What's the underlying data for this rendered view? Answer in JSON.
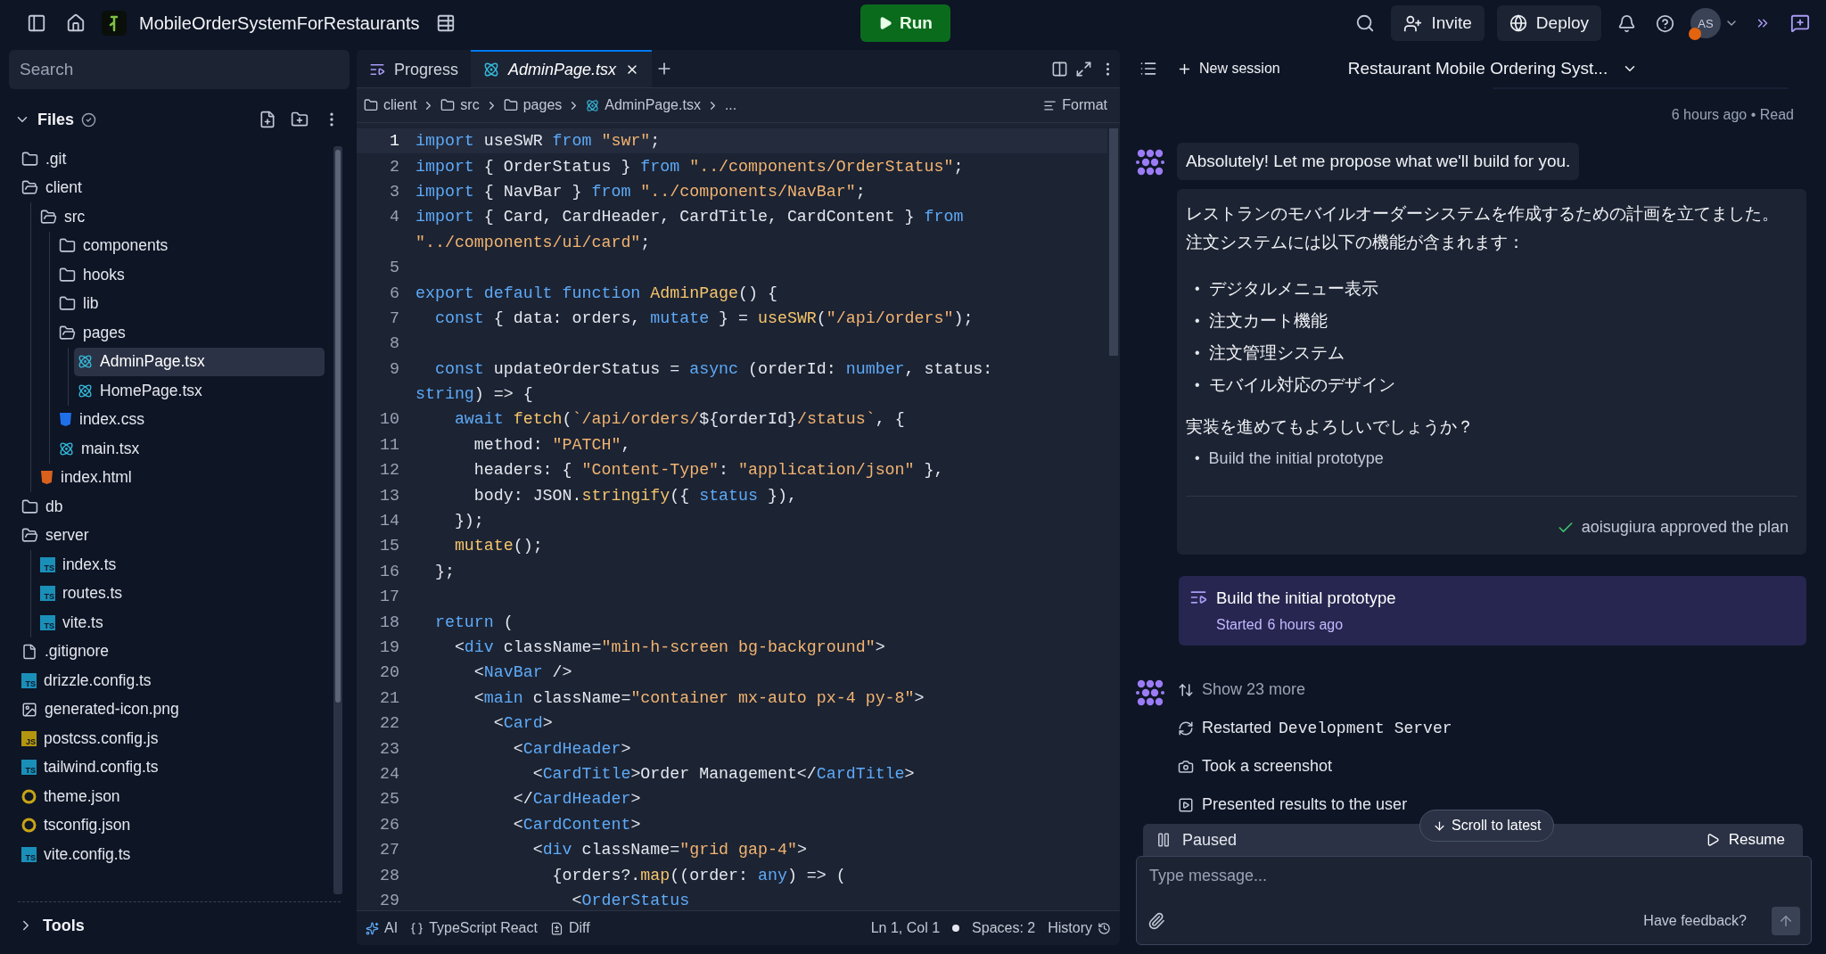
{
  "topbar": {
    "project": "MobileOrderSystemForRestaurants",
    "run": "Run",
    "invite": "Invite",
    "deploy": "Deploy",
    "avatar": "AS"
  },
  "sidebar": {
    "search": {
      "placeholder": "Search"
    },
    "files_label": "Files",
    "tools_label": "Tools",
    "tree": [
      {
        "name": ".git",
        "kind": "folder",
        "expanded": false
      },
      {
        "name": "client",
        "kind": "folder",
        "expanded": true,
        "children": [
          {
            "name": "src",
            "kind": "folder",
            "expanded": true,
            "children": [
              {
                "name": "components",
                "kind": "folder",
                "expanded": false
              },
              {
                "name": "hooks",
                "kind": "folder",
                "expanded": false
              },
              {
                "name": "lib",
                "kind": "folder",
                "expanded": false
              },
              {
                "name": "pages",
                "kind": "folder",
                "expanded": true,
                "children": [
                  {
                    "name": "AdminPage.tsx",
                    "kind": "react",
                    "selected": true
                  },
                  {
                    "name": "HomePage.tsx",
                    "kind": "react",
                    "selected": false
                  }
                ]
              },
              {
                "name": "index.css",
                "kind": "css",
                "selected": false
              },
              {
                "name": "main.tsx",
                "kind": "react",
                "selected": false
              }
            ]
          },
          {
            "name": "index.html",
            "kind": "html",
            "selected": false
          }
        ]
      },
      {
        "name": "db",
        "kind": "folder",
        "expanded": false
      },
      {
        "name": "server",
        "kind": "folder",
        "expanded": true,
        "children": [
          {
            "name": "index.ts",
            "kind": "ts",
            "badge": "TS",
            "selected": false
          },
          {
            "name": "routes.ts",
            "kind": "ts",
            "badge": "TS",
            "selected": false
          },
          {
            "name": "vite.ts",
            "kind": "ts",
            "badge": "TS",
            "selected": false
          }
        ]
      },
      {
        "name": ".gitignore",
        "kind": "file",
        "selected": false
      },
      {
        "name": "drizzle.config.ts",
        "kind": "ts",
        "badge": "TS",
        "selected": false
      },
      {
        "name": "generated-icon.png",
        "kind": "image",
        "selected": false
      },
      {
        "name": "postcss.config.js",
        "kind": "js",
        "badge": "JS",
        "selected": false
      },
      {
        "name": "tailwind.config.ts",
        "kind": "ts",
        "badge": "TS",
        "selected": false
      },
      {
        "name": "theme.json",
        "kind": "json",
        "selected": false
      },
      {
        "name": "tsconfig.json",
        "kind": "json",
        "selected": false
      },
      {
        "name": "vite.config.ts",
        "kind": "ts",
        "badge": "TS",
        "selected": false
      }
    ]
  },
  "editor": {
    "tabs": [
      {
        "label": "Progress",
        "kind": "progress",
        "selected": false
      },
      {
        "label": "AdminPage.tsx",
        "kind": "react",
        "selected": true
      }
    ],
    "breadcrumb": [
      "client",
      "src",
      "pages",
      "AdminPage.tsx",
      "..."
    ],
    "format": "Format",
    "lines": [
      {
        "number": "1",
        "current": true,
        "rows": [
          [
            {
              "text": "import",
              "kind": "keyword"
            },
            {
              "text": " useSWR ",
              "kind": "plain"
            },
            {
              "text": "from",
              "kind": "keyword"
            },
            {
              "text": " ",
              "kind": "plain"
            },
            {
              "text": "\"swr\"",
              "kind": "string"
            },
            {
              "text": ";",
              "kind": "plain"
            }
          ]
        ]
      },
      {
        "number": "2",
        "current": false,
        "rows": [
          [
            {
              "text": "import",
              "kind": "keyword"
            },
            {
              "text": " { OrderStatus } ",
              "kind": "plain"
            },
            {
              "text": "from",
              "kind": "keyword"
            },
            {
              "text": " ",
              "kind": "plain"
            },
            {
              "text": "\"../components/OrderStatus\"",
              "kind": "string"
            },
            {
              "text": ";",
              "kind": "plain"
            }
          ]
        ]
      },
      {
        "number": "3",
        "current": false,
        "rows": [
          [
            {
              "text": "import",
              "kind": "keyword"
            },
            {
              "text": " { NavBar } ",
              "kind": "plain"
            },
            {
              "text": "from",
              "kind": "keyword"
            },
            {
              "text": " ",
              "kind": "plain"
            },
            {
              "text": "\"../components/NavBar\"",
              "kind": "string"
            },
            {
              "text": ";",
              "kind": "plain"
            }
          ]
        ]
      },
      {
        "number": "4",
        "current": false,
        "rows": [
          [
            {
              "text": "import",
              "kind": "keyword"
            },
            {
              "text": " { Card, CardHeader, CardTitle, CardContent } ",
              "kind": "plain"
            },
            {
              "text": "from",
              "kind": "keyword"
            }
          ],
          [
            {
              "text": "\"../components/ui/card\"",
              "kind": "string"
            },
            {
              "text": ";",
              "kind": "plain"
            }
          ]
        ]
      },
      {
        "number": "5",
        "current": false
      },
      {
        "number": "6",
        "current": false,
        "rows": [
          [
            {
              "text": "export default function",
              "kind": "keyword"
            },
            {
              "text": " ",
              "kind": "plain"
            },
            {
              "text": "AdminPage",
              "kind": "function"
            },
            {
              "text": "() {",
              "kind": "plain"
            }
          ]
        ]
      },
      {
        "number": "7",
        "current": false,
        "rows": [
          [
            {
              "text": "  ",
              "kind": "plain"
            },
            {
              "text": "const",
              "kind": "keyword"
            },
            {
              "text": " { data: orders, ",
              "kind": "plain"
            },
            {
              "text": "mutate",
              "kind": "keyword"
            },
            {
              "text": " } = ",
              "kind": "plain"
            },
            {
              "text": "useSWR",
              "kind": "function"
            },
            {
              "text": "(",
              "kind": "plain"
            },
            {
              "text": "\"/api/orders\"",
              "kind": "string"
            },
            {
              "text": ");",
              "kind": "plain"
            }
          ]
        ]
      },
      {
        "number": "8",
        "current": false
      },
      {
        "number": "9",
        "current": false,
        "rows": [
          [
            {
              "text": "  ",
              "kind": "plain"
            },
            {
              "text": "const",
              "kind": "keyword"
            },
            {
              "text": " updateOrderStatus = ",
              "kind": "plain"
            },
            {
              "text": "async",
              "kind": "keyword"
            },
            {
              "text": " (orderId: ",
              "kind": "plain"
            },
            {
              "text": "number",
              "kind": "keyword"
            },
            {
              "text": ", status:",
              "kind": "plain"
            }
          ],
          [
            {
              "text": "string",
              "kind": "keyword"
            },
            {
              "text": ") => {",
              "kind": "plain"
            }
          ]
        ]
      },
      {
        "number": "10",
        "current": false,
        "rows": [
          [
            {
              "text": "    ",
              "kind": "plain"
            },
            {
              "text": "await",
              "kind": "keyword"
            },
            {
              "text": " ",
              "kind": "plain"
            },
            {
              "text": "fetch",
              "kind": "function"
            },
            {
              "text": "(",
              "kind": "plain"
            },
            {
              "text": "`/api/orders/",
              "kind": "string"
            },
            {
              "text": "${orderId}",
              "kind": "plain"
            },
            {
              "text": "/status`",
              "kind": "string"
            },
            {
              "text": ", {",
              "kind": "plain"
            }
          ]
        ]
      },
      {
        "number": "11",
        "current": false,
        "rows": [
          [
            {
              "text": "      method: ",
              "kind": "plain"
            },
            {
              "text": "\"PATCH\"",
              "kind": "string"
            },
            {
              "text": ",",
              "kind": "plain"
            }
          ]
        ]
      },
      {
        "number": "12",
        "current": false,
        "rows": [
          [
            {
              "text": "      headers: { ",
              "kind": "plain"
            },
            {
              "text": "\"Content-Type\"",
              "kind": "string"
            },
            {
              "text": ": ",
              "kind": "plain"
            },
            {
              "text": "\"application/json\"",
              "kind": "string"
            },
            {
              "text": " },",
              "kind": "plain"
            }
          ]
        ]
      },
      {
        "number": "13",
        "current": false,
        "rows": [
          [
            {
              "text": "      body: JSON.",
              "kind": "plain"
            },
            {
              "text": "stringify",
              "kind": "function"
            },
            {
              "text": "({ ",
              "kind": "plain"
            },
            {
              "text": "status",
              "kind": "keyword"
            },
            {
              "text": " }),",
              "kind": "plain"
            }
          ]
        ]
      },
      {
        "number": "14",
        "current": false,
        "rows": [
          [
            {
              "text": "    });",
              "kind": "plain"
            }
          ]
        ]
      },
      {
        "number": "15",
        "current": false,
        "rows": [
          [
            {
              "text": "    ",
              "kind": "plain"
            },
            {
              "text": "mutate",
              "kind": "function"
            },
            {
              "text": "();",
              "kind": "plain"
            }
          ]
        ]
      },
      {
        "number": "16",
        "current": false,
        "rows": [
          [
            {
              "text": "  };",
              "kind": "plain"
            }
          ]
        ]
      },
      {
        "number": "17",
        "current": false
      },
      {
        "number": "18",
        "current": false,
        "rows": [
          [
            {
              "text": "  ",
              "kind": "plain"
            },
            {
              "text": "return",
              "kind": "keyword"
            },
            {
              "text": " (",
              "kind": "plain"
            }
          ]
        ]
      },
      {
        "number": "19",
        "current": false,
        "rows": [
          [
            {
              "text": "    <",
              "kind": "plain"
            },
            {
              "text": "div",
              "kind": "keyword"
            },
            {
              "text": " className=",
              "kind": "plain"
            },
            {
              "text": "\"min-h-screen bg-background\"",
              "kind": "string"
            },
            {
              "text": ">",
              "kind": "plain"
            }
          ]
        ]
      },
      {
        "number": "20",
        "current": false,
        "rows": [
          [
            {
              "text": "      <",
              "kind": "plain"
            },
            {
              "text": "NavBar",
              "kind": "keyword"
            },
            {
              "text": " />",
              "kind": "plain"
            }
          ]
        ]
      },
      {
        "number": "21",
        "current": false,
        "rows": [
          [
            {
              "text": "      <",
              "kind": "plain"
            },
            {
              "text": "main",
              "kind": "keyword"
            },
            {
              "text": " className=",
              "kind": "plain"
            },
            {
              "text": "\"container mx-auto px-4 py-8\"",
              "kind": "string"
            },
            {
              "text": ">",
              "kind": "plain"
            }
          ]
        ]
      },
      {
        "number": "22",
        "current": false,
        "rows": [
          [
            {
              "text": "        <",
              "kind": "plain"
            },
            {
              "text": "Card",
              "kind": "keyword"
            },
            {
              "text": ">",
              "kind": "plain"
            }
          ]
        ]
      },
      {
        "number": "23",
        "current": false,
        "rows": [
          [
            {
              "text": "          <",
              "kind": "plain"
            },
            {
              "text": "CardHeader",
              "kind": "keyword"
            },
            {
              "text": ">",
              "kind": "plain"
            }
          ]
        ]
      },
      {
        "number": "24",
        "current": false,
        "rows": [
          [
            {
              "text": "            <",
              "kind": "plain"
            },
            {
              "text": "CardTitle",
              "kind": "keyword"
            },
            {
              "text": ">Order Management</",
              "kind": "plain"
            },
            {
              "text": "CardTitle",
              "kind": "keyword"
            },
            {
              "text": ">",
              "kind": "plain"
            }
          ]
        ]
      },
      {
        "number": "25",
        "current": false,
        "rows": [
          [
            {
              "text": "          </",
              "kind": "plain"
            },
            {
              "text": "CardHeader",
              "kind": "keyword"
            },
            {
              "text": ">",
              "kind": "plain"
            }
          ]
        ]
      },
      {
        "number": "26",
        "current": false,
        "rows": [
          [
            {
              "text": "          <",
              "kind": "plain"
            },
            {
              "text": "CardContent",
              "kind": "keyword"
            },
            {
              "text": ">",
              "kind": "plain"
            }
          ]
        ]
      },
      {
        "number": "27",
        "current": false,
        "rows": [
          [
            {
              "text": "            <",
              "kind": "plain"
            },
            {
              "text": "div",
              "kind": "keyword"
            },
            {
              "text": " className=",
              "kind": "plain"
            },
            {
              "text": "\"grid gap-4\"",
              "kind": "string"
            },
            {
              "text": ">",
              "kind": "plain"
            }
          ]
        ]
      },
      {
        "number": "28",
        "current": false,
        "rows": [
          [
            {
              "text": "              {orders?.",
              "kind": "plain"
            },
            {
              "text": "map",
              "kind": "function"
            },
            {
              "text": "((order: ",
              "kind": "plain"
            },
            {
              "text": "any",
              "kind": "keyword"
            },
            {
              "text": ") => (",
              "kind": "plain"
            }
          ]
        ]
      },
      {
        "number": "29",
        "current": false,
        "rows": [
          [
            {
              "text": "                <",
              "kind": "plain"
            },
            {
              "text": "OrderStatus",
              "kind": "keyword"
            }
          ]
        ]
      }
    ],
    "status_bar": {
      "ai": "AI",
      "language": "TypeScript React",
      "diff": "Diff",
      "position": "Ln 1, Col 1",
      "spaces": "Spaces: 2",
      "history": "History"
    }
  },
  "chat": {
    "new_session": "New session",
    "title": "Restaurant Mobile Ordering Syst...",
    "meta": "6 hours ago • Read",
    "agent_message": "Absolutely! Let me propose what we'll build for you.",
    "plan": {
      "intro": [
        "レストランのモバイルオーダーシステムを作成するための計画を立てました。",
        "注文システムには以下の機能が含まれます："
      ],
      "bullet": "•",
      "features": [
        "デジタルメニュー表示",
        "注文カート機能",
        "注文管理システム",
        "モバイル対応のデザイン"
      ],
      "question": "実装を進めてもよろしいでしょうか？",
      "steps": [
        "Build the initial prototype"
      ],
      "approval": "aoisugiura approved the plan"
    },
    "task": {
      "title": "Build the initial prototype",
      "status": "Started",
      "time": "6 hours ago"
    },
    "activities": [
      {
        "kind": "expand",
        "text": "Show 23 more"
      },
      {
        "kind": "restart",
        "text": "Restarted",
        "code": "Development Server"
      },
      {
        "kind": "camera",
        "text": "Took a screenshot"
      },
      {
        "kind": "present",
        "text": "Presented results to the user"
      }
    ],
    "paused": {
      "label": "Paused",
      "resume": "Resume",
      "scroll": "Scroll to latest"
    },
    "composer": {
      "placeholder": "Type message...",
      "feedback": "Have feedback?"
    }
  }
}
